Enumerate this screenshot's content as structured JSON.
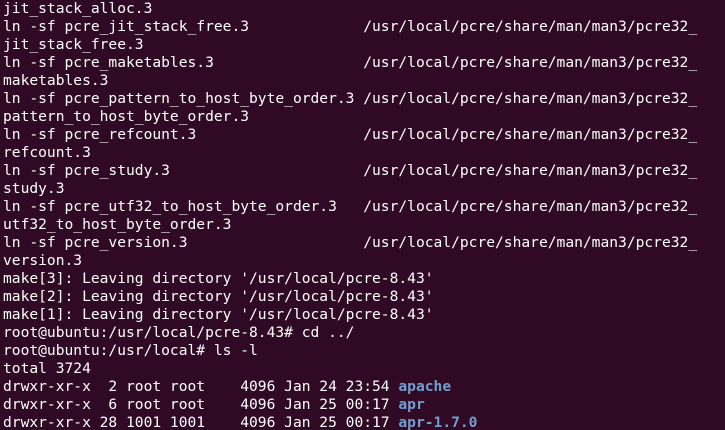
{
  "terminal": {
    "background": "#300a24",
    "foreground": "#ffffff",
    "directory_color": "#729fcf",
    "lines": [
      {
        "text": "jit_stack_alloc.3"
      },
      {
        "text": "ln -sf pcre_jit_stack_free.3             /usr/local/pcre/share/man/man3/pcre32_"
      },
      {
        "text": "jit_stack_free.3"
      },
      {
        "text": "ln -sf pcre_maketables.3                 /usr/local/pcre/share/man/man3/pcre32_"
      },
      {
        "text": "maketables.3"
      },
      {
        "text": "ln -sf pcre_pattern_to_host_byte_order.3 /usr/local/pcre/share/man/man3/pcre32_"
      },
      {
        "text": "pattern_to_host_byte_order.3"
      },
      {
        "text": "ln -sf pcre_refcount.3                   /usr/local/pcre/share/man/man3/pcre32_"
      },
      {
        "text": "refcount.3"
      },
      {
        "text": "ln -sf pcre_study.3                      /usr/local/pcre/share/man/man3/pcre32_"
      },
      {
        "text": "study.3"
      },
      {
        "text": "ln -sf pcre_utf32_to_host_byte_order.3   /usr/local/pcre/share/man/man3/pcre32_"
      },
      {
        "text": "utf32_to_host_byte_order.3"
      },
      {
        "text": "ln -sf pcre_version.3                    /usr/local/pcre/share/man/man3/pcre32_"
      },
      {
        "text": "version.3"
      },
      {
        "text": "make[3]: Leaving directory '/usr/local/pcre-8.43'"
      },
      {
        "text": "make[2]: Leaving directory '/usr/local/pcre-8.43'"
      },
      {
        "text": "make[1]: Leaving directory '/usr/local/pcre-8.43'"
      },
      {
        "text": "root@ubuntu:/usr/local/pcre-8.43# cd ../"
      },
      {
        "text": "root@ubuntu:/usr/local# ls -l"
      },
      {
        "text": "total 3724"
      },
      {
        "text": "drwxr-xr-x  2 root root    4096 Jan 24 23:54 ",
        "dir": "apache"
      },
      {
        "text": "drwxr-xr-x  6 root root    4096 Jan 25 00:17 ",
        "dir": "apr"
      },
      {
        "text": "drwxr-xr-x 28 1001 1001    4096 Jan 25 00:17 ",
        "dir": "apr-1.7.0"
      }
    ]
  }
}
